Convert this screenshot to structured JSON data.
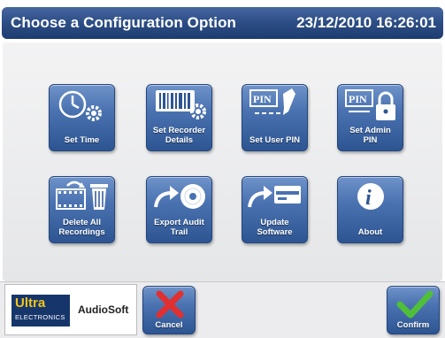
{
  "header": {
    "title": "Choose a Configuration Option",
    "datetime": "23/12/2010 16:26:01"
  },
  "options": [
    {
      "label_line1": "Set Time",
      "label_line2": "",
      "icon": "clock-gear-icon"
    },
    {
      "label_line1": "Set Recorder",
      "label_line2": "Details",
      "icon": "recorder-barcode-gear-icon"
    },
    {
      "label_line1": "Set User PIN",
      "label_line2": "",
      "icon": "pin-pen-icon"
    },
    {
      "label_line1": "Set Admin",
      "label_line2": "PIN",
      "icon": "pin-lock-icon"
    },
    {
      "label_line1": "Delete All",
      "label_line2": "Recordings",
      "icon": "film-trash-icon"
    },
    {
      "label_line1": "Export Audit",
      "label_line2": "Trail",
      "icon": "arrow-disc-icon"
    },
    {
      "label_line1": "Update",
      "label_line2": "Software",
      "icon": "arrow-card-icon"
    },
    {
      "label_line1": "About",
      "label_line2": "",
      "icon": "info-icon"
    }
  ],
  "footer": {
    "logo_ultra": "Ultra",
    "logo_electronics": "ELECTRONICS",
    "product": "AudioSoft",
    "cancel_label": "Cancel",
    "confirm_label": "Confirm"
  },
  "colors": {
    "title_bar": "#2e4f87",
    "tile": "#4a72b0",
    "cancel_x": "#e03030",
    "confirm_check": "#4fbf3a"
  }
}
